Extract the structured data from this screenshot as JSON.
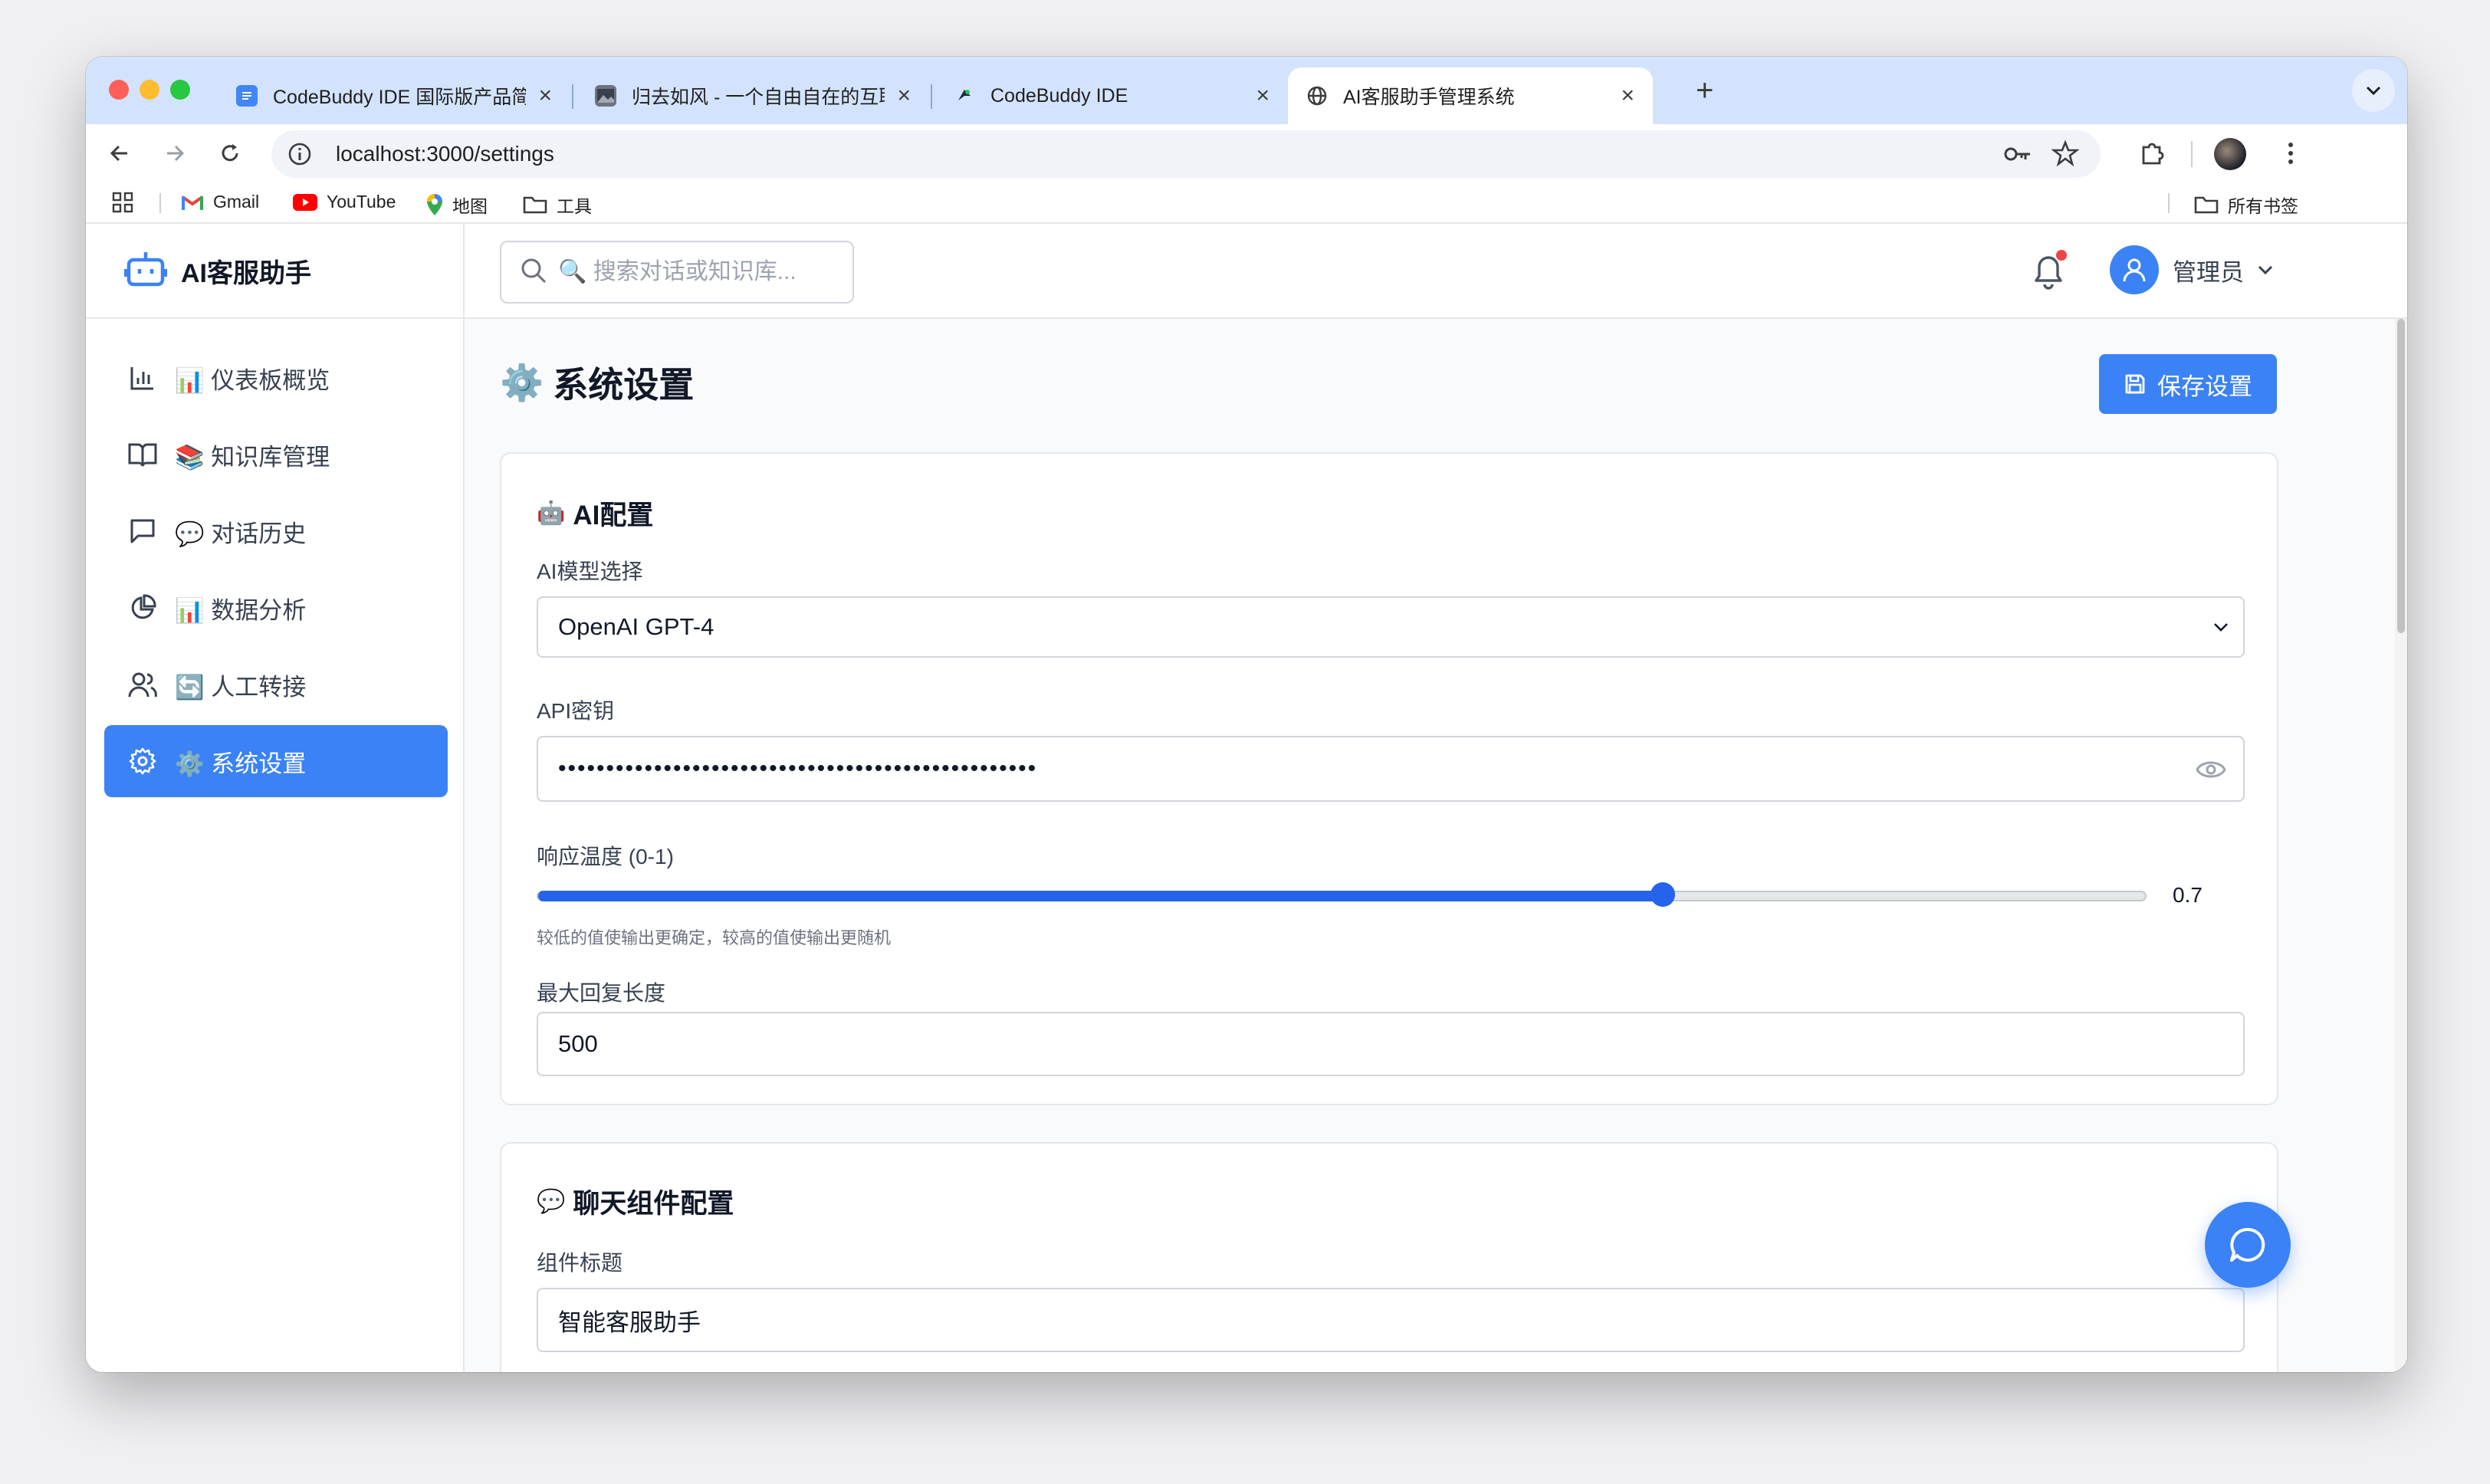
{
  "browser": {
    "tabs": [
      {
        "title": "CodeBuddy IDE 国际版产品简",
        "icon": "docs-icon"
      },
      {
        "title": "归去如风 - 一个自由自在的互联",
        "icon": "image-icon"
      },
      {
        "title": "CodeBuddy IDE",
        "icon": "codebuddy-icon"
      },
      {
        "title": "AI客服助手管理系统",
        "icon": "globe-icon"
      }
    ],
    "url": "localhost:3000/settings",
    "bookmarks": [
      {
        "label": "Gmail"
      },
      {
        "label": "YouTube"
      },
      {
        "label": "地图"
      },
      {
        "label": "工具"
      }
    ],
    "all_bookmarks": "所有书签"
  },
  "app": {
    "name": "AI客服助手",
    "search_placeholder": "🔍 搜索对话或知识库...",
    "user_name": "管理员",
    "nav": [
      {
        "label": "📊 仪表板概览",
        "icon": "bar-chart-icon"
      },
      {
        "label": "📚 知识库管理",
        "icon": "book-icon"
      },
      {
        "label": "💬 对话历史",
        "icon": "message-icon"
      },
      {
        "label": "📊 数据分析",
        "icon": "pie-chart-icon"
      },
      {
        "label": "🔄 人工转接",
        "icon": "users-icon"
      },
      {
        "label": "⚙️ 系统设置",
        "icon": "settings-icon",
        "active": true
      }
    ]
  },
  "page": {
    "title": "系统设置",
    "title_emoji": "⚙️",
    "save_label": "保存设置",
    "ai_config": {
      "title": "AI配置",
      "emoji": "🤖",
      "model_label": "AI模型选择",
      "model_value": "OpenAI GPT-4",
      "api_label": "API密钥",
      "api_value": "••••••••••••••••••••••••••••••••••••••••••••••••••",
      "temp_label": "响应温度 (0-1)",
      "temp_value": "0.7",
      "temp_fraction": 0.7,
      "temp_hint": "较低的值使输出更确定，较高的值使输出更随机",
      "max_label": "最大回复长度",
      "max_value": "500"
    },
    "chat_config": {
      "title": "聊天组件配置",
      "emoji": "💬",
      "widget_title_label": "组件标题",
      "widget_title_value": "智能客服助手"
    }
  },
  "colors": {
    "primary": "#3b82f6",
    "tabstrip": "#d3e3fd",
    "notification": "#ef4444"
  }
}
